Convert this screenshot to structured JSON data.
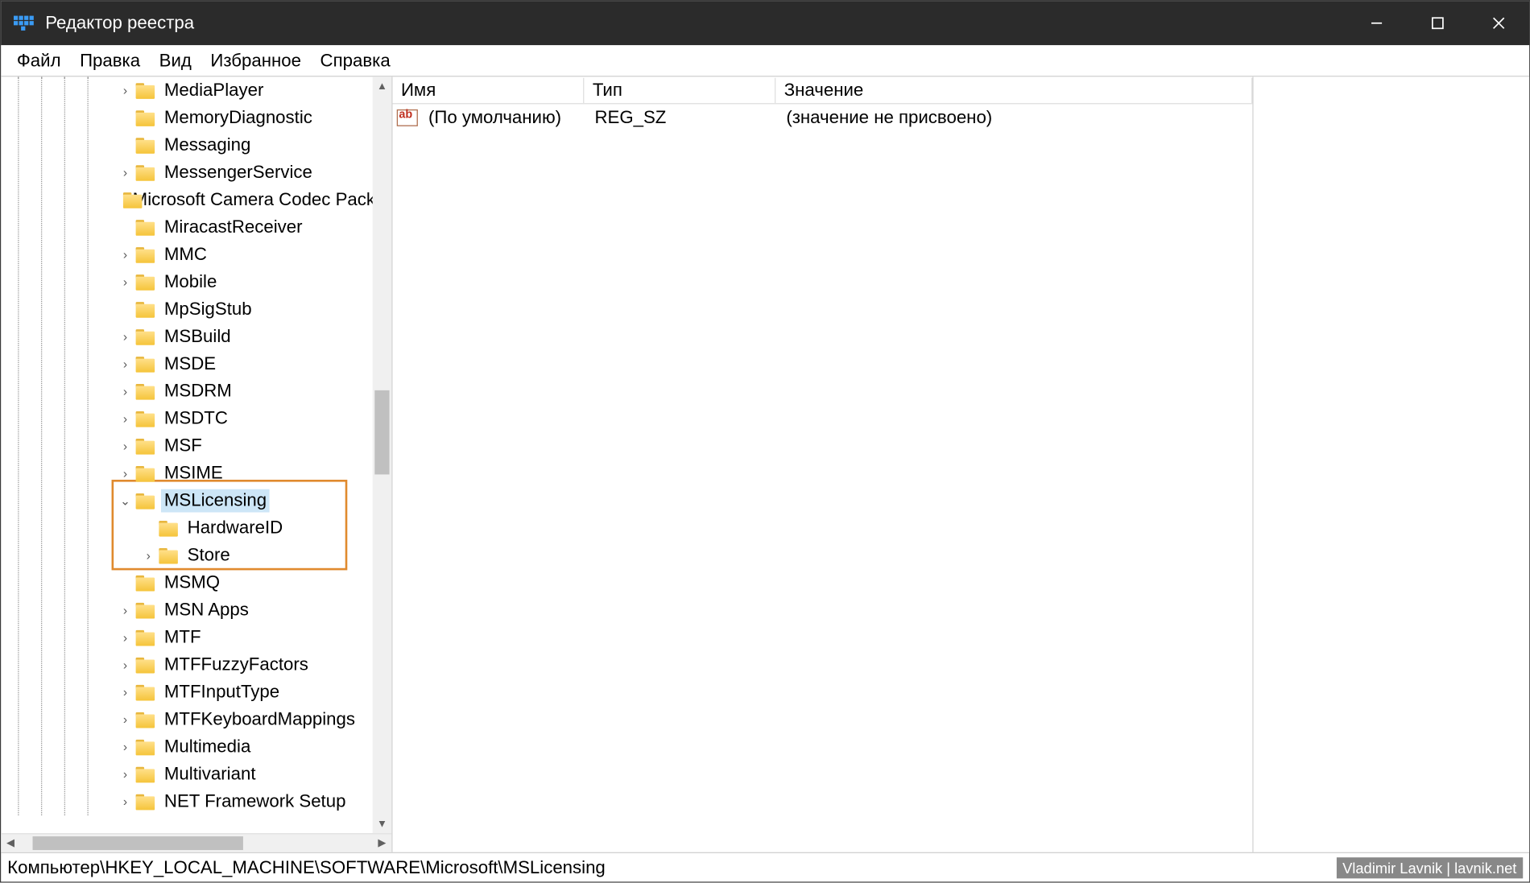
{
  "titlebar": {
    "title": "Редактор реестра"
  },
  "menu": {
    "file": "Файл",
    "edit": "Правка",
    "view": "Вид",
    "favorites": "Избранное",
    "help": "Справка"
  },
  "tree": {
    "items": [
      {
        "label": "MediaPlayer",
        "expander": "closed",
        "indent": 5
      },
      {
        "label": "MemoryDiagnostic",
        "expander": "none",
        "indent": 5
      },
      {
        "label": "Messaging",
        "expander": "none",
        "indent": 5
      },
      {
        "label": "MessengerService",
        "expander": "closed",
        "indent": 5
      },
      {
        "label": "Microsoft Camera Codec Pack",
        "expander": "none",
        "indent": 5
      },
      {
        "label": "MiracastReceiver",
        "expander": "none",
        "indent": 5
      },
      {
        "label": "MMC",
        "expander": "closed",
        "indent": 5
      },
      {
        "label": "Mobile",
        "expander": "closed",
        "indent": 5
      },
      {
        "label": "MpSigStub",
        "expander": "none",
        "indent": 5
      },
      {
        "label": "MSBuild",
        "expander": "closed",
        "indent": 5
      },
      {
        "label": "MSDE",
        "expander": "closed",
        "indent": 5
      },
      {
        "label": "MSDRM",
        "expander": "closed",
        "indent": 5
      },
      {
        "label": "MSDTC",
        "expander": "closed",
        "indent": 5
      },
      {
        "label": "MSF",
        "expander": "closed",
        "indent": 5
      },
      {
        "label": "MSIME",
        "expander": "closed",
        "indent": 5
      },
      {
        "label": "MSLicensing",
        "expander": "open",
        "indent": 5,
        "selected": true
      },
      {
        "label": "HardwareID",
        "expander": "none",
        "indent": 6
      },
      {
        "label": "Store",
        "expander": "closed",
        "indent": 6
      },
      {
        "label": "MSMQ",
        "expander": "none",
        "indent": 5
      },
      {
        "label": "MSN Apps",
        "expander": "closed",
        "indent": 5
      },
      {
        "label": "MTF",
        "expander": "closed",
        "indent": 5
      },
      {
        "label": "MTFFuzzyFactors",
        "expander": "closed",
        "indent": 5
      },
      {
        "label": "MTFInputType",
        "expander": "closed",
        "indent": 5
      },
      {
        "label": "MTFKeyboardMappings",
        "expander": "closed",
        "indent": 5
      },
      {
        "label": "Multimedia",
        "expander": "closed",
        "indent": 5
      },
      {
        "label": "Multivariant",
        "expander": "closed",
        "indent": 5
      },
      {
        "label": "NET Framework Setup",
        "expander": "closed",
        "indent": 5
      }
    ]
  },
  "columns": {
    "name": "Имя",
    "type": "Тип",
    "value": "Значение"
  },
  "values": [
    {
      "name": "(По умолчанию)",
      "type": "REG_SZ",
      "value": "(значение не присвоено)"
    }
  ],
  "statusbar": {
    "path": "Компьютер\\HKEY_LOCAL_MACHINE\\SOFTWARE\\Microsoft\\MSLicensing"
  },
  "watermark": {
    "text": "Vladimir Lavnik | lavnik.net"
  }
}
